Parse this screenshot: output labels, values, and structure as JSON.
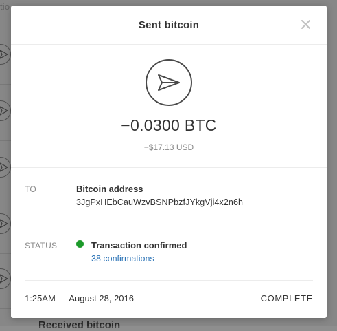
{
  "background": {
    "top_text": "tio",
    "bottom_text": "Received bitcoin"
  },
  "modal": {
    "title": "Sent bitcoin",
    "close_icon": "close-icon",
    "hero_icon": "send-icon",
    "amount_btc": "−0.0300 BTC",
    "amount_usd": "−$17.13 USD"
  },
  "to": {
    "label": "TO",
    "title": "Bitcoin address",
    "address": "3JgPxHEbCauWzvBSNPbzfJYkgVji4x2n6h"
  },
  "status": {
    "label": "STATUS",
    "text": "Transaction confirmed",
    "confirmations": "38 confirmations",
    "color": "#1c9a2a"
  },
  "footer": {
    "datetime": "1:25AM — August 28, 2016",
    "state": "COMPLETE"
  },
  "colors": {
    "link": "#2b73b6",
    "overlay": "rgba(0,0,0,0.42)"
  }
}
